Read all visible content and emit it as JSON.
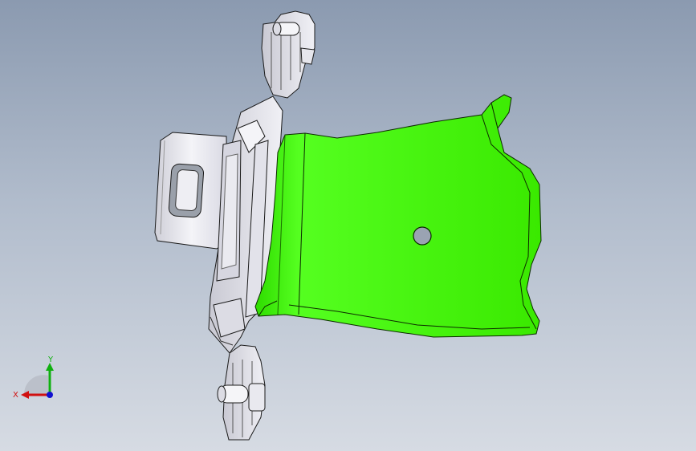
{
  "viewport": {
    "background_top": "#8b9ab0",
    "background_bottom": "#d6dbe3"
  },
  "model": {
    "highlight_color": "#33e600",
    "part_color": "#e8e8ee",
    "edge_color": "#1a1a1a",
    "hole": "round-hole"
  },
  "triad": {
    "x_label": "X",
    "y_label": "Y",
    "x_color": "#d01010",
    "y_color": "#10b010",
    "z_color": "#1010d0"
  }
}
